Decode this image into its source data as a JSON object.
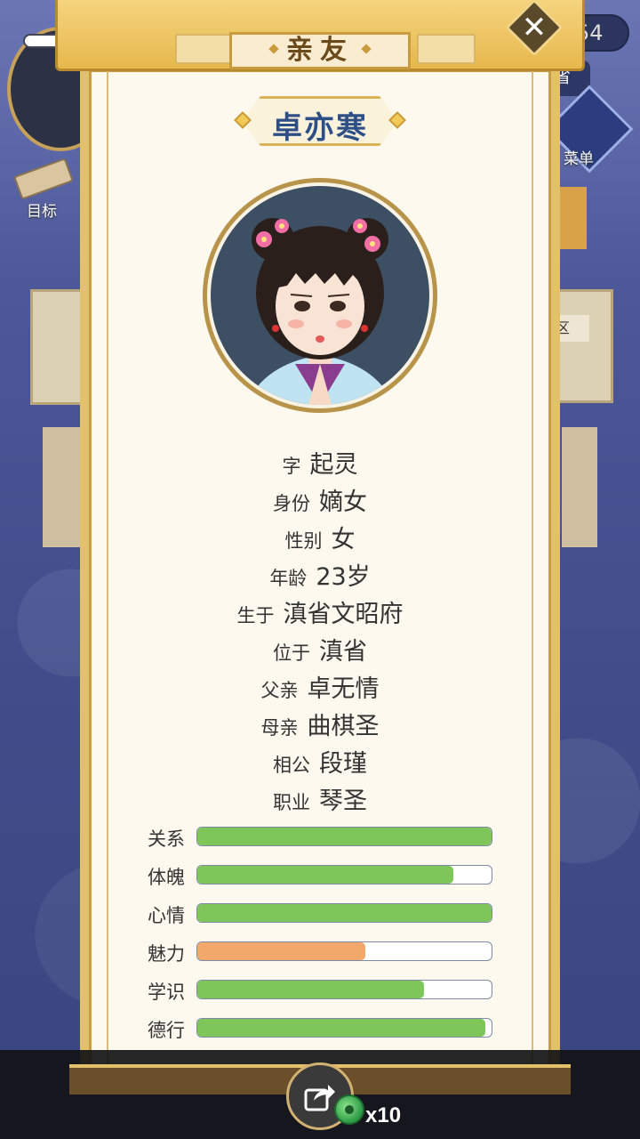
{
  "background": {
    "currency_partial": "54",
    "province_partial": "省",
    "target_label": "目标",
    "menu_label": "菜单",
    "area_partial": "区"
  },
  "modal": {
    "title": "亲友",
    "close_icon": "close-icon",
    "character_name": "卓亦寒",
    "info": [
      {
        "key": "字",
        "value": "起灵"
      },
      {
        "key": "身份",
        "value": "嫡女"
      },
      {
        "key": "性别",
        "value": "女"
      },
      {
        "key": "年龄",
        "value": "23岁"
      },
      {
        "key": "生于",
        "value": "滇省文昭府"
      },
      {
        "key": "位于",
        "value": "滇省"
      },
      {
        "key": "父亲",
        "value": "卓无情"
      },
      {
        "key": "母亲",
        "value": "曲棋圣"
      },
      {
        "key": "相公",
        "value": "段瑾"
      },
      {
        "key": "职业",
        "value": "琴圣"
      }
    ],
    "stats": [
      {
        "label": "关系",
        "percent": 100,
        "color": "#7ec65a"
      },
      {
        "label": "体魄",
        "percent": 87,
        "color": "#7ec65a"
      },
      {
        "label": "心情",
        "percent": 100,
        "color": "#7ec65a"
      },
      {
        "label": "魅力",
        "percent": 57,
        "color": "#f2a86a"
      },
      {
        "label": "学识",
        "percent": 77,
        "color": "#7ec65a"
      },
      {
        "label": "德行",
        "percent": 98,
        "color": "#7ec65a"
      }
    ]
  },
  "bottom": {
    "share_icon": "share-icon",
    "jade_icon": "jade-icon",
    "count": "x10"
  }
}
